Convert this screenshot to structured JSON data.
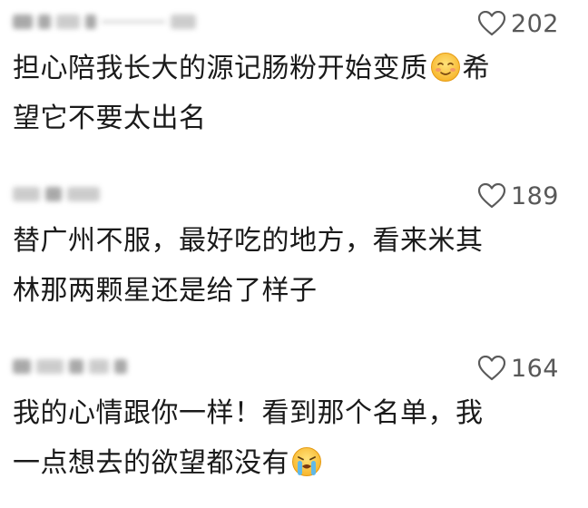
{
  "comments": [
    {
      "likes": "202",
      "text_lines": [
        "担心陪我长大的源记肠粉开始变质",
        "希",
        "望它不要太出名"
      ],
      "emoji": "smiling-face-emoji"
    },
    {
      "likes": "189",
      "text_lines": [
        "替广州不服，最好吃的地方，看来米其",
        "林那两颗星还是给了样子"
      ]
    },
    {
      "likes": "164",
      "text_lines": [
        "我的心情跟你一样！看到那个名单，我",
        "一点想去的欲望都没有"
      ],
      "emoji": "crying-face-emoji"
    }
  ],
  "colors": {
    "text": "#1a1a1a",
    "like_count": "#585858",
    "heart_outline": "#5a5a5a"
  }
}
